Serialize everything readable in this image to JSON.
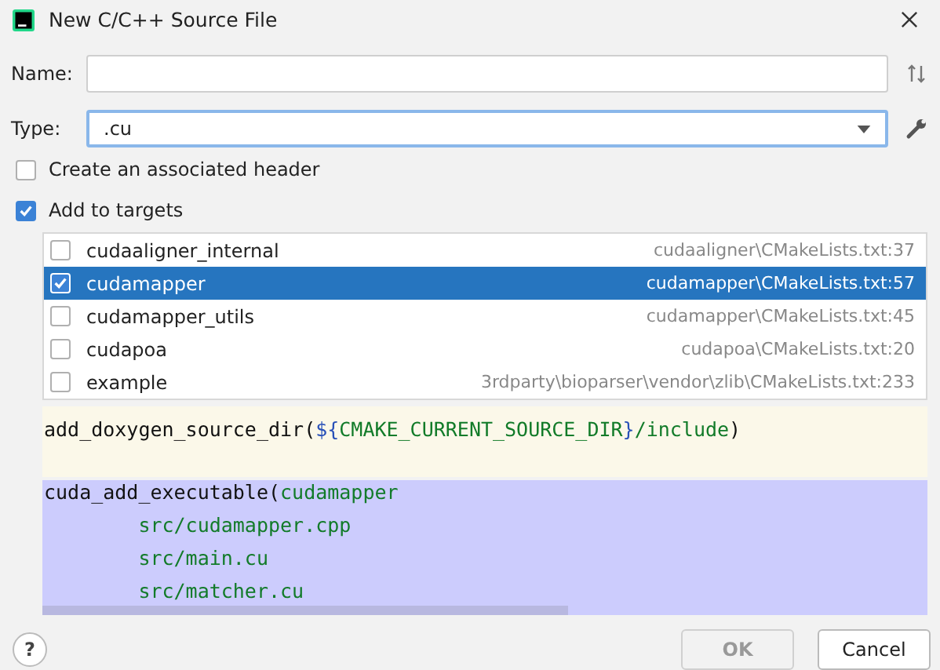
{
  "window": {
    "title": "New C/C++ Source File"
  },
  "name_field": {
    "label": "Name:"
  },
  "type_field": {
    "label": "Type:",
    "value": ".cu",
    "focused": true
  },
  "options": [
    {
      "label": "Create an associated header",
      "checked": false
    },
    {
      "label": "Add to targets",
      "checked": true
    }
  ],
  "targets": [
    {
      "name": "cudaaligner_internal",
      "path": "cudaaligner\\CMakeLists.txt:37",
      "checked": false,
      "selected": false
    },
    {
      "name": "cudamapper",
      "path": "cudamapper\\CMakeLists.txt:57",
      "checked": true,
      "selected": true
    },
    {
      "name": "cudamapper_utils",
      "path": "cudamapper\\CMakeLists.txt:45",
      "checked": false,
      "selected": false
    },
    {
      "name": "cudapoa",
      "path": "cudapoa\\CMakeLists.txt:20",
      "checked": false,
      "selected": false
    },
    {
      "name": "example",
      "path": "3rdparty\\bioparser\\vendor\\zlib\\CMakeLists.txt:233",
      "checked": false,
      "selected": false
    }
  ],
  "preview": [
    {
      "highlighted": false,
      "lines": [
        [
          {
            "kind": "plain",
            "text": "add_doxygen_source_dir("
          },
          {
            "kind": "brace",
            "text": "${"
          },
          {
            "kind": "string",
            "text": "CMAKE_CURRENT_SOURCE_DIR"
          },
          {
            "kind": "brace",
            "text": "}"
          },
          {
            "kind": "string",
            "text": "/include"
          },
          {
            "kind": "plain",
            "text": ")"
          }
        ]
      ]
    },
    {
      "highlighted": true,
      "lines": [
        [
          {
            "kind": "plain",
            "text": "cuda_add_executable("
          },
          {
            "kind": "string",
            "text": "cudamapper"
          }
        ],
        [
          {
            "kind": "string",
            "text": "        src/cudamapper.cpp"
          }
        ],
        [
          {
            "kind": "string",
            "text": "        src/main.cu"
          }
        ],
        [
          {
            "kind": "string",
            "text": "        src/matcher.cu"
          }
        ]
      ]
    }
  ],
  "help": {
    "label": "?"
  },
  "buttons": [
    {
      "label": "OK",
      "disabled": true
    },
    {
      "label": "Cancel",
      "disabled": false
    }
  ]
}
